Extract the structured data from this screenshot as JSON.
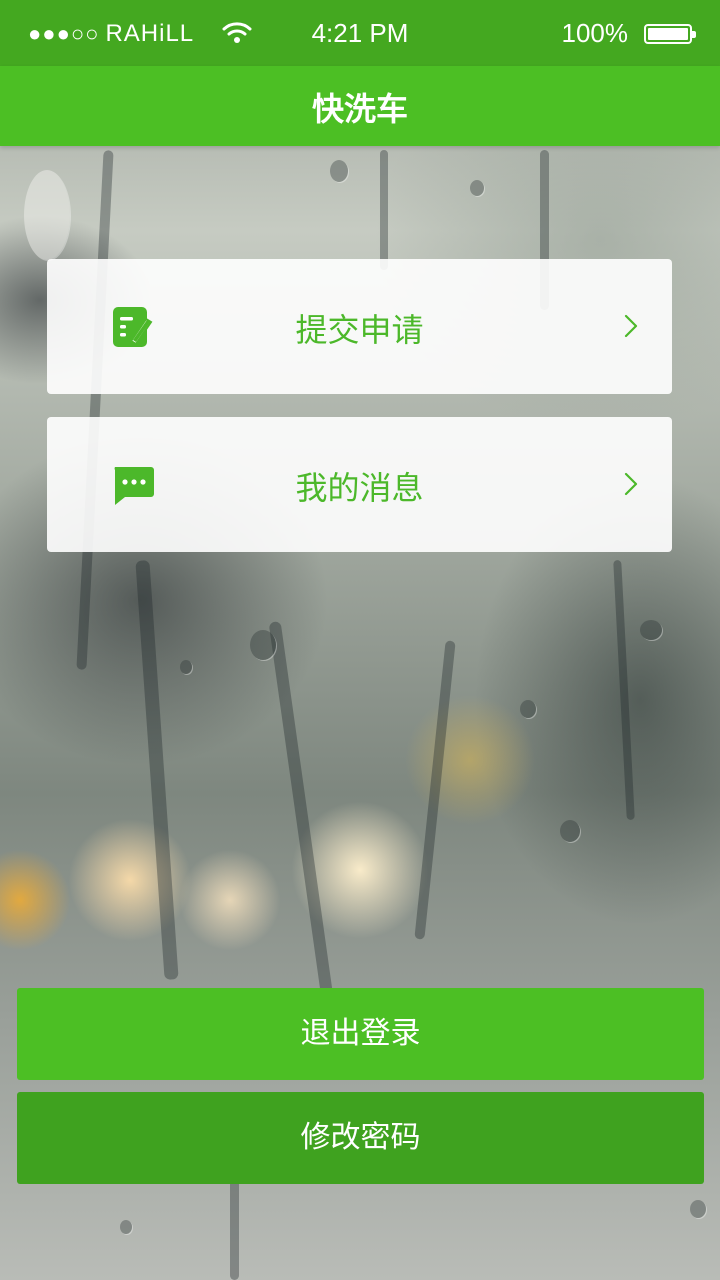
{
  "status_bar": {
    "signal_dots": "●●●○○",
    "carrier": "RAHiLL",
    "time": "4:21 PM",
    "battery": "100%"
  },
  "nav": {
    "title": "快洗车"
  },
  "menu": [
    {
      "label": "提交申请",
      "icon": "edit-form-icon"
    },
    {
      "label": "我的消息",
      "icon": "message-bubble-icon"
    }
  ],
  "buttons": {
    "logout": "退出登录",
    "change_password": "修改密码"
  },
  "colors": {
    "status_bar": "#44a820",
    "nav_bar": "#4cbf24",
    "accent_text": "#4cb82a",
    "logout_button": "#4cbf24",
    "password_button": "#3fa21f"
  }
}
